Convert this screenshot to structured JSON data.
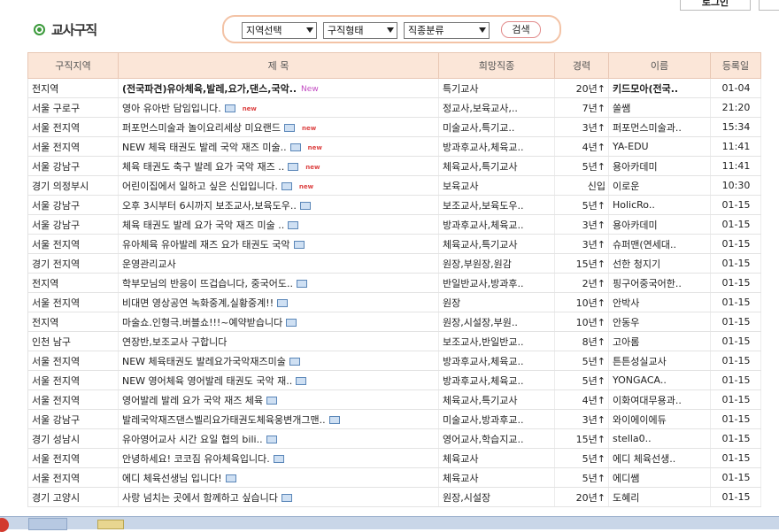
{
  "top_buttons": {
    "login": "로그인"
  },
  "page_title": "교사구직",
  "search": {
    "region": "지역선택",
    "type": "구직형태",
    "category": "직종분류",
    "button": "검색"
  },
  "columns": {
    "region": "구직지역",
    "title": "제 목",
    "job": "희망직종",
    "career": "경력",
    "name": "이름",
    "date": "등록일"
  },
  "rows": [
    {
      "region": "전지역",
      "title": "(전국파견)유아체육,발레,요가,댄스,국악..",
      "badge": "New",
      "job": "특기교사",
      "career": "20년↑",
      "name": "키드모아(전국..",
      "date": "01-04"
    },
    {
      "region": "서울 구로구",
      "title": "영아 유아반 담임입니다.",
      "badge": "new",
      "job": "정교사,보육교사,..",
      "career": "7년↑",
      "name": "쏠쌤",
      "date": "21:20"
    },
    {
      "region": "서울 전지역",
      "title": "퍼포먼스미술과 놀이요리세상 미요랜드",
      "badge": "new",
      "job": "미술교사,특기교..",
      "career": "3년↑",
      "name": "퍼포먼스미술과..",
      "date": "15:34"
    },
    {
      "region": "서울 전지역",
      "title": "NEW 체육 태권도 발레 국악 재즈 미술..",
      "badge": "new",
      "job": "방과후교사,체육교..",
      "career": "4년↑",
      "name": "YA-EDU",
      "date": "11:41"
    },
    {
      "region": "서울 강남구",
      "title": "체육 태권도 축구 발레 요가 국악 재즈 ..",
      "badge": "new",
      "job": "체육교사,특기교사",
      "career": "5년↑",
      "name": "용아카데미",
      "date": "11:41"
    },
    {
      "region": "경기 의정부시",
      "title": "어린이집에서 일하고 싶은 신입입니다.",
      "badge": "new",
      "job": "보육교사",
      "career": "신입",
      "name": "이로운",
      "date": "10:30"
    },
    {
      "region": "서울 강남구",
      "title": "오후 3시부터 6시까지 보조교사,보육도우..",
      "badge": "",
      "job": "보조교사,보육도우..",
      "career": "5년↑",
      "name": "HolicRo..",
      "date": "01-15"
    },
    {
      "region": "서울 강남구",
      "title": "체육 태권도 발레 요가 국악 재즈 미술 ..",
      "badge": "",
      "job": "방과후교사,체육교..",
      "career": "3년↑",
      "name": "용아카데미",
      "date": "01-15"
    },
    {
      "region": "서울 전지역",
      "title": "유아체육 유아발레 재즈 요가 태권도 국악",
      "badge": "",
      "job": "체육교사,특기교사",
      "career": "3년↑",
      "name": "슈퍼맨(연세대..",
      "date": "01-15"
    },
    {
      "region": "경기 전지역",
      "title": "운영관리교사",
      "badge": "",
      "job": "원장,부원장,원감",
      "career": "15년↑",
      "name": "선한 청지기",
      "date": "01-15"
    },
    {
      "region": "전지역",
      "title": "학부모님의 반응이 뜨겁습니다, 중국어도..",
      "badge": "",
      "job": "반일반교사,방과후..",
      "career": "2년↑",
      "name": "핑구어중국어한..",
      "date": "01-15"
    },
    {
      "region": "서울 전지역",
      "title": "비대면 영상공연 녹화중계,실황중계!!",
      "badge": "",
      "job": "원장",
      "career": "10년↑",
      "name": "안박사",
      "date": "01-15"
    },
    {
      "region": "전지역",
      "title": "마술쇼.인형극.버블쇼!!!~예약받습니다",
      "badge": "",
      "job": "원장,시설장,부원..",
      "career": "10년↑",
      "name": "안동우",
      "date": "01-15"
    },
    {
      "region": "인천 남구",
      "title": "연장반,보조교사 구합니다",
      "badge": "",
      "job": "보조교사,반일반교..",
      "career": "8년↑",
      "name": "고아롬",
      "date": "01-15"
    },
    {
      "region": "서울 전지역",
      "title": "NEW 체육태권도 발레요가국악재즈미술",
      "badge": "",
      "job": "방과후교사,체육교..",
      "career": "5년↑",
      "name": "튼튼성실교사",
      "date": "01-15"
    },
    {
      "region": "서울 전지역",
      "title": "NEW 영어체육 영어발레 태권도 국악 재..",
      "badge": "",
      "job": "방과후교사,체육교..",
      "career": "5년↑",
      "name": "YONGACA..",
      "date": "01-15"
    },
    {
      "region": "서울 전지역",
      "title": "영어발레 발레 요가 국악 재즈 체육",
      "badge": "",
      "job": "체육교사,특기교사",
      "career": "4년↑",
      "name": "이화여대무용과..",
      "date": "01-15"
    },
    {
      "region": "서울 강남구",
      "title": "발레국악재즈댄스벨리요가태권도체육웅변개그맨..",
      "badge": "",
      "job": "미술교사,방과후교..",
      "career": "3년↑",
      "name": "와이에이에듀",
      "date": "01-15"
    },
    {
      "region": "경기 성남시",
      "title": "유아영어교사 시간 요일 협의 bili..",
      "badge": "",
      "job": "영어교사,학습지교..",
      "career": "15년↑",
      "name": "stella0..",
      "date": "01-15"
    },
    {
      "region": "서울 전지역",
      "title": "안녕하세요! 코코짐 유아체육입니다.",
      "badge": "",
      "job": "체육교사",
      "career": "5년↑",
      "name": "에디 체육선생..",
      "date": "01-15"
    },
    {
      "region": "서울 전지역",
      "title": "에디 체육선생님 입니다!",
      "badge": "",
      "job": "체육교사",
      "career": "5년↑",
      "name": "에디쌤",
      "date": "01-15"
    },
    {
      "region": "경기 고양시",
      "title": "사랑 넘치는 곳에서 함께하고 싶습니다",
      "badge": "",
      "job": "원장,시설장",
      "career": "20년↑",
      "name": "도혜리",
      "date": "01-15"
    }
  ]
}
